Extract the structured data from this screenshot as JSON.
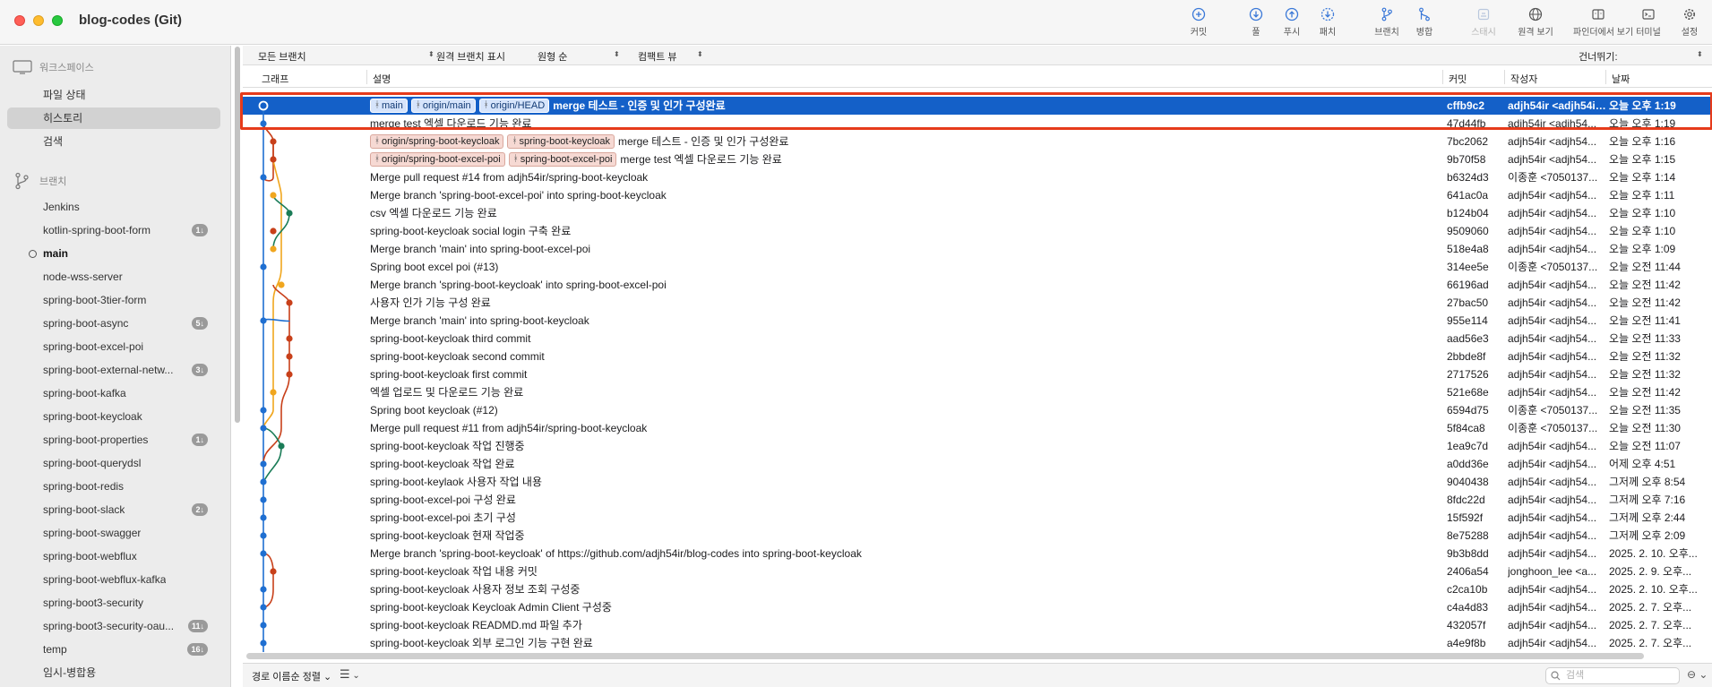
{
  "window": {
    "title": "blog-codes (Git)"
  },
  "toolbar": [
    {
      "key": "commit",
      "label": "커밋",
      "icon": "plus-circle-icon",
      "enabled": true
    },
    {
      "key": "pull",
      "label": "풀",
      "icon": "arrow-down-circle-icon",
      "enabled": true
    },
    {
      "key": "push",
      "label": "푸시",
      "icon": "arrow-up-circle-icon",
      "enabled": true
    },
    {
      "key": "fetch",
      "label": "패치",
      "icon": "dashed-arrow-down-circle-icon",
      "enabled": true
    },
    {
      "key": "branch",
      "label": "브랜치",
      "icon": "branch-icon",
      "enabled": true
    },
    {
      "key": "merge",
      "label": "병합",
      "icon": "merge-icon",
      "enabled": true
    },
    {
      "key": "stash",
      "label": "스태시",
      "icon": "stash-icon",
      "enabled": false
    },
    {
      "key": "remote",
      "label": "원격 보기",
      "icon": "globe-icon",
      "enabled": true
    },
    {
      "key": "finder",
      "label": "파인더에서 보기",
      "icon": "finder-icon",
      "enabled": true
    },
    {
      "key": "terminal",
      "label": "터미널",
      "icon": "terminal-icon",
      "enabled": true
    },
    {
      "key": "settings",
      "label": "설정",
      "icon": "gear-icon",
      "enabled": true
    }
  ],
  "sidebar": {
    "workspace_header": "워크스페이스",
    "workspace_items": [
      {
        "label": "파일 상태",
        "selected": false
      },
      {
        "label": "히스토리",
        "selected": true
      },
      {
        "label": "검색",
        "selected": false
      }
    ],
    "branches_header": "브랜치",
    "branches": [
      {
        "name": "Jenkins",
        "badge": ""
      },
      {
        "name": "kotlin-spring-boot-form",
        "badge": "1↓"
      },
      {
        "name": "main",
        "badge": "",
        "current": true
      },
      {
        "name": "node-wss-server",
        "badge": ""
      },
      {
        "name": "spring-boot-3tier-form",
        "badge": ""
      },
      {
        "name": "spring-boot-async",
        "badge": "5↓"
      },
      {
        "name": "spring-boot-excel-poi",
        "badge": ""
      },
      {
        "name": "spring-boot-external-netw...",
        "badge": "3↓"
      },
      {
        "name": "spring-boot-kafka",
        "badge": ""
      },
      {
        "name": "spring-boot-keycloak",
        "badge": ""
      },
      {
        "name": "spring-boot-properties",
        "badge": "1↓"
      },
      {
        "name": "spring-boot-querydsl",
        "badge": ""
      },
      {
        "name": "spring-boot-redis",
        "badge": ""
      },
      {
        "name": "spring-boot-slack",
        "badge": "2↓"
      },
      {
        "name": "spring-boot-swagger",
        "badge": ""
      },
      {
        "name": "spring-boot-webflux",
        "badge": ""
      },
      {
        "name": "spring-boot-webflux-kafka",
        "badge": ""
      },
      {
        "name": "spring-boot3-security",
        "badge": ""
      },
      {
        "name": "spring-boot3-security-oau...",
        "badge": "11↓"
      },
      {
        "name": "temp",
        "badge": "16↓"
      },
      {
        "name": "임시-병합용",
        "badge": ""
      }
    ]
  },
  "filters": {
    "branches": "모든 브랜치",
    "remote_branches": "원격 브랜치 표시",
    "order": "원형 순",
    "compact": "컴팩트 뷰",
    "skip": "건너뛰기:"
  },
  "columns": {
    "graph": "그래프",
    "description": "설명",
    "commit": "커밋",
    "author": "작성자",
    "date": "날짜"
  },
  "commits": [
    {
      "tags": [
        {
          "label": "main",
          "type": "local"
        },
        {
          "label": "origin/main",
          "type": "local"
        },
        {
          "label": "origin/HEAD",
          "type": "local"
        }
      ],
      "message": "merge 테스트 - 인증 및 인가 구성완료",
      "hash": "cffb9c2",
      "author": "adjh54ir <adjh54ir@...>",
      "date": "오늘 오후 1:19",
      "selected": true
    },
    {
      "tags": [],
      "message": "merge test 엑셀 다운로드 기능 완료",
      "hash": "47d44fb",
      "author": "adjh54ir <adjh54...",
      "date": "오늘 오후 1:19"
    },
    {
      "tags": [
        {
          "label": "origin/spring-boot-keycloak",
          "type": "remote"
        },
        {
          "label": "spring-boot-keycloak",
          "type": "remote"
        }
      ],
      "message": "merge 테스트 - 인증 및 인가 구성완료",
      "hash": "7bc2062",
      "author": "adjh54ir <adjh54...",
      "date": "오늘 오후 1:16"
    },
    {
      "tags": [
        {
          "label": "origin/spring-boot-excel-poi",
          "type": "remote"
        },
        {
          "label": "spring-boot-excel-poi",
          "type": "remote"
        }
      ],
      "message": "merge test 엑셀 다운로드 기능 완료",
      "hash": "9b70f58",
      "author": "adjh54ir <adjh54...",
      "date": "오늘 오후 1:15"
    },
    {
      "tags": [],
      "message": "Merge pull request #14 from adjh54ir/spring-boot-keycloak",
      "hash": "b6324d3",
      "author": "이종훈 <7050137...",
      "date": "오늘 오후 1:14"
    },
    {
      "tags": [],
      "message": "Merge branch 'spring-boot-excel-poi' into spring-boot-keycloak",
      "hash": "641ac0a",
      "author": "adjh54ir <adjh54...",
      "date": "오늘 오후 1:11"
    },
    {
      "tags": [],
      "message": "csv 엑셀 다운로드 기능 완료",
      "hash": "b124b04",
      "author": "adjh54ir <adjh54...",
      "date": "오늘 오후 1:10"
    },
    {
      "tags": [],
      "message": "spring-boot-keycloak social login 구축 완료",
      "hash": "9509060",
      "author": "adjh54ir <adjh54...",
      "date": "오늘 오후 1:10"
    },
    {
      "tags": [],
      "message": "Merge branch 'main' into spring-boot-excel-poi",
      "hash": "518e4a8",
      "author": "adjh54ir <adjh54...",
      "date": "오늘 오후 1:09"
    },
    {
      "tags": [],
      "message": "Spring boot excel poi (#13)",
      "hash": "314ee5e",
      "author": "이종훈 <7050137...",
      "date": "오늘 오전 11:44"
    },
    {
      "tags": [],
      "message": "Merge branch 'spring-boot-keycloak' into spring-boot-excel-poi",
      "hash": "66196ad",
      "author": "adjh54ir <adjh54...",
      "date": "오늘 오전 11:42"
    },
    {
      "tags": [],
      "message": "사용자 인가 기능 구성 완료",
      "hash": "27bac50",
      "author": "adjh54ir <adjh54...",
      "date": "오늘 오전 11:42"
    },
    {
      "tags": [],
      "message": "Merge branch 'main' into spring-boot-keycloak",
      "hash": "955e114",
      "author": "adjh54ir <adjh54...",
      "date": "오늘 오전 11:41"
    },
    {
      "tags": [],
      "message": "spring-boot-keycloak third commit",
      "hash": "aad56e3",
      "author": "adjh54ir <adjh54...",
      "date": "오늘 오전 11:33"
    },
    {
      "tags": [],
      "message": "spring-boot-keycloak second commit",
      "hash": "2bbde8f",
      "author": "adjh54ir <adjh54...",
      "date": "오늘 오전 11:32"
    },
    {
      "tags": [],
      "message": "spring-boot-keycloak first commit",
      "hash": "2717526",
      "author": "adjh54ir <adjh54...",
      "date": "오늘 오전 11:32"
    },
    {
      "tags": [],
      "message": "엑셀 업로드 및 다운로드 기능 완료",
      "hash": "521e68e",
      "author": "adjh54ir <adjh54...",
      "date": "오늘 오전 11:42"
    },
    {
      "tags": [],
      "message": "Spring boot keycloak (#12)",
      "hash": "6594d75",
      "author": "이종훈 <7050137...",
      "date": "오늘 오전 11:35"
    },
    {
      "tags": [],
      "message": "Merge pull request #11 from adjh54ir/spring-boot-keycloak",
      "hash": "5f84ca8",
      "author": "이종훈 <7050137...",
      "date": "오늘 오전 11:30"
    },
    {
      "tags": [],
      "message": "spring-boot-keycloak 작업 진행중",
      "hash": "1ea9c7d",
      "author": "adjh54ir <adjh54...",
      "date": "오늘 오전 11:07"
    },
    {
      "tags": [],
      "message": "spring-boot-keycloak 작업 완료",
      "hash": "a0dd36e",
      "author": "adjh54ir <adjh54...",
      "date": "어제 오후 4:51"
    },
    {
      "tags": [],
      "message": "spring-boot-keylaok 사용자 작업 내용",
      "hash": "9040438",
      "author": "adjh54ir <adjh54...",
      "date": "그저께 오후 8:54"
    },
    {
      "tags": [],
      "message": "spring-boot-excel-poi 구성 완료",
      "hash": "8fdc22d",
      "author": "adjh54ir <adjh54...",
      "date": "그저께 오후 7:16"
    },
    {
      "tags": [],
      "message": "spring-boot-excel-poi 초기 구성",
      "hash": "15f592f",
      "author": "adjh54ir <adjh54...",
      "date": "그저께 오후 2:44"
    },
    {
      "tags": [],
      "message": "spring-boot-keycloak 현재 작업중",
      "hash": "8e75288",
      "author": "adjh54ir <adjh54...",
      "date": "그저께 오후 2:09"
    },
    {
      "tags": [],
      "message": "Merge branch 'spring-boot-keycloak' of https://github.com/adjh54ir/blog-codes into spring-boot-keycloak",
      "hash": "9b3b8dd",
      "author": "adjh54ir <adjh54...",
      "date": "2025. 2. 10. 오후..."
    },
    {
      "tags": [],
      "message": "spring-boot-keycloak 작업 내용 커밋",
      "hash": "2406a54",
      "author": "jonghoon_lee <a...",
      "date": "2025. 2. 9. 오후..."
    },
    {
      "tags": [],
      "message": "spring-boot-keycloak 사용자 정보 조회 구성중",
      "hash": "c2ca10b",
      "author": "adjh54ir <adjh54...",
      "date": "2025. 2. 10. 오후..."
    },
    {
      "tags": [],
      "message": "spring-boot-keycloak Keycloak Admin Client 구성중",
      "hash": "c4a4d83",
      "author": "adjh54ir <adjh54...",
      "date": "2025. 2. 7. 오후..."
    },
    {
      "tags": [],
      "message": "spring-boot-keycloak READMD.md 파일 추가",
      "hash": "432057f",
      "author": "adjh54ir <adjh54...",
      "date": "2025. 2. 7. 오후..."
    },
    {
      "tags": [],
      "message": "spring-boot-keycloak 외부 로그인 기능 구현 완료",
      "hash": "a4e9f8b",
      "author": "adjh54ir <adjh54...",
      "date": "2025. 2. 7. 오후..."
    }
  ],
  "bottombar": {
    "sort": "경로 이름순 정렬",
    "search_placeholder": "검색"
  },
  "colors": {
    "selection": "#1460c8",
    "highlight_box": "#e63b1b",
    "lane_blue": "#1f6fd1",
    "lane_red": "#c8401a",
    "lane_orange": "#f0a61e",
    "lane_green": "#1a7c57"
  }
}
